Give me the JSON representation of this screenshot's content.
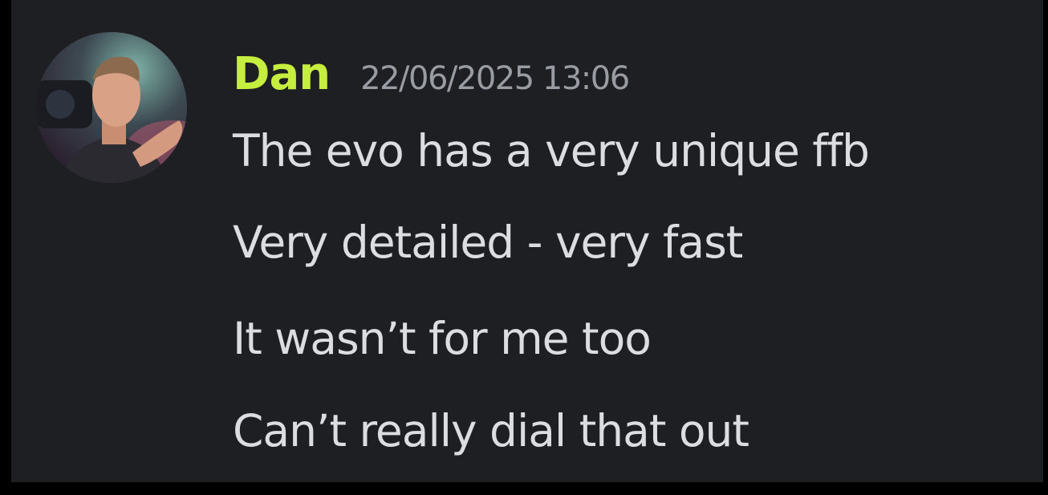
{
  "theme": {
    "background": "#1e1f23",
    "username_color": "#c6ee3f",
    "timestamp_color": "#9a9ca3",
    "text_color": "#dcdde0"
  },
  "message": {
    "author": "Dan",
    "timestamp": "22/06/2025 13:06",
    "lines": [
      "The evo has a very unique ffb",
      "Very detailed - very fast",
      "It wasn’t for me too",
      "Can’t really dial that out"
    ],
    "avatar_icon": "user-avatar-photo"
  }
}
